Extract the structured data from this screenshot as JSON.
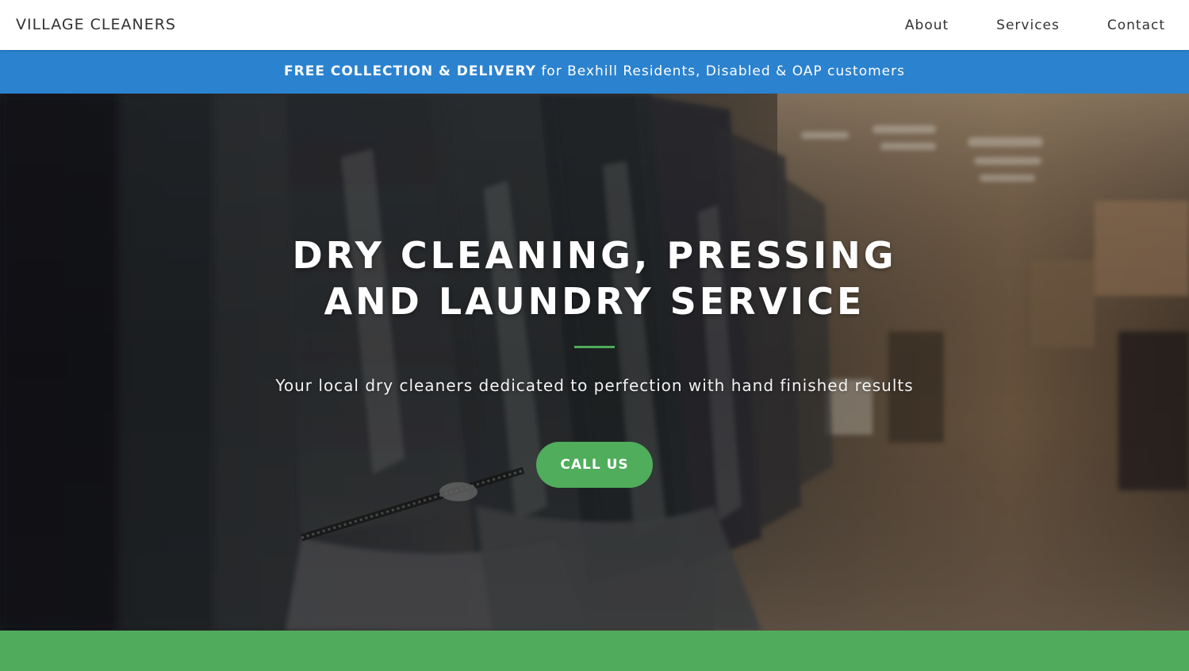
{
  "navbar": {
    "brand": "VILLAGE CLEANERS",
    "links": [
      "About",
      "Services",
      "Contact"
    ]
  },
  "banner": {
    "bold_text": "FREE COLLECTION & DELIVERY",
    "text": " for Bexhill Residents, Disabled & OAP customers"
  },
  "hero": {
    "title_line1": "DRY CLEANING, PRESSING",
    "title_line2": "AND LAUNDRY SERVICE",
    "tagline": "Your local dry cleaners dedicated to perfection with hand finished results",
    "cta_label": "CALL US"
  },
  "colors": {
    "banner_blue": "#2b82cf",
    "accent_green": "#4fad5b",
    "nav_text": "#333333"
  }
}
